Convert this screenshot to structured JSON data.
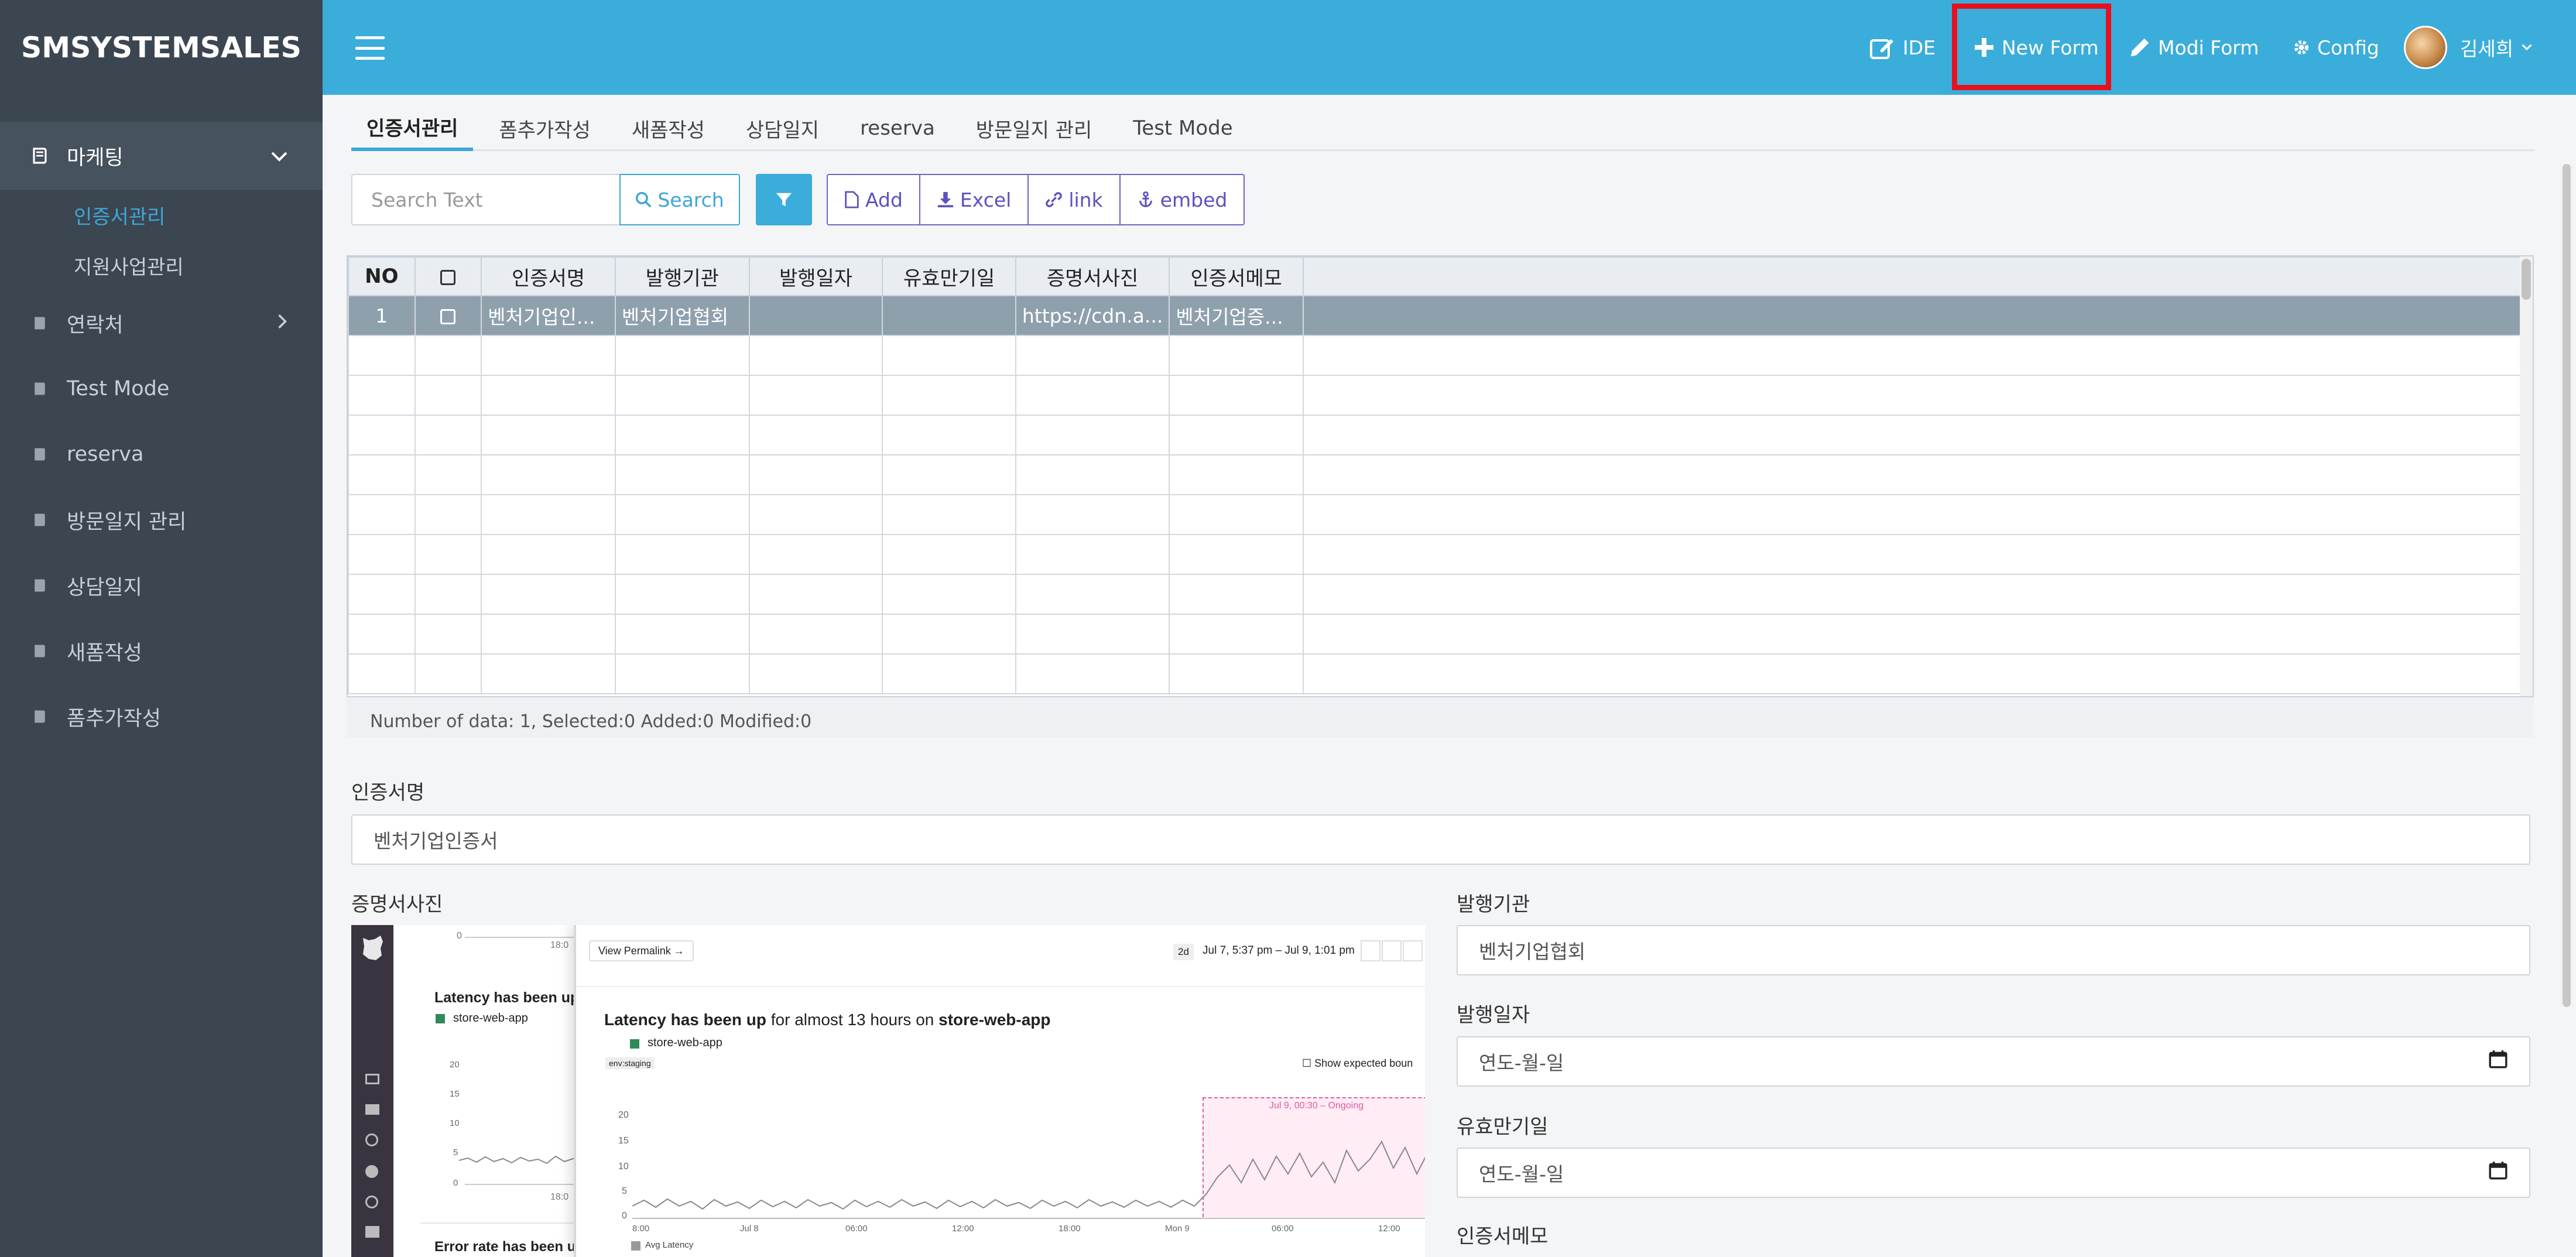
{
  "app": {
    "brand": "SMSYSTEMSALES"
  },
  "sidebar": {
    "items": [
      {
        "label": "마케팅",
        "active": true
      },
      {
        "label": "연락처"
      },
      {
        "label": "Test Mode"
      },
      {
        "label": "reserva"
      },
      {
        "label": "방문일지 관리"
      },
      {
        "label": "상담일지"
      },
      {
        "label": "새폼작성"
      },
      {
        "label": "폼추가작성"
      }
    ],
    "submenu": [
      {
        "label": "인증서관리",
        "active": true
      },
      {
        "label": "지원사업관리"
      }
    ]
  },
  "topbar": {
    "ide": "IDE",
    "new_form": "New Form",
    "modi_form": "Modi Form",
    "config": "Config",
    "user": "김세희",
    "accent": "#3badda",
    "highlight": "#e8101e"
  },
  "tabs": [
    "인증서관리",
    "폼추가작성",
    "새폼작성",
    "상담일지",
    "reserva",
    "방문일지 관리",
    "Test Mode"
  ],
  "toolbar": {
    "search_placeholder": "Search Text",
    "search": "Search",
    "add": "Add",
    "excel": "Excel",
    "link": "link",
    "embed": "embed"
  },
  "grid": {
    "headers": [
      "NO",
      "",
      "인증서명",
      "발행기관",
      "발행일자",
      "유효만기일",
      "증명서사진",
      "인증서메모"
    ],
    "rows": [
      [
        "1",
        "",
        "벤처기업인...",
        "벤처기업협회",
        "",
        "",
        "https://cdn.a...",
        "벤처기업증..."
      ]
    ],
    "status": "Number of data: 1, Selected:0 Added:0 Modified:0"
  },
  "form": {
    "cert_name_label": "인증서명",
    "cert_name_value": "벤처기업인증서",
    "photo_label": "증명서사진",
    "issuer_label": "발행기관",
    "issuer_value": "벤처기업협회",
    "issue_date_label": "발행일자",
    "issue_date_value": "연도-월-일",
    "expiry_label": "유효만기일",
    "expiry_value": "연도-월-일",
    "memo_label": "인증서메모"
  },
  "preview": {
    "permalink": "View Permalink →",
    "range_badge": "2d",
    "range": "Jul 7, 5:37 pm – Jul 9, 1:01 pm",
    "title_bold": "Latency has been up",
    "title_rest": " for almost 13 hours on ",
    "title_app": "store-web-app",
    "series": "store-web-app",
    "env": "env:staging",
    "show_expected": "Show expected boun",
    "ongoing": "Jul 9, 00:30 – Ongoing",
    "legend": "Avg Latency",
    "left_title": "Latency has been up",
    "left_series": "store-web-app",
    "left_error": "Error rate has been u",
    "y_ticks": [
      "20",
      "15",
      "10",
      "5",
      "0"
    ],
    "left_y_ticks": [
      "20",
      "15",
      "10",
      "5",
      "0"
    ],
    "x_ticks": [
      "8:00",
      "Jul 8",
      "06:00",
      "12:00",
      "18:00",
      "Mon 9",
      "06:00",
      "12:00"
    ],
    "left_top_tick": "0",
    "left_x_tick_top": "18:0",
    "left_x_tick_bottom": "18:0"
  }
}
